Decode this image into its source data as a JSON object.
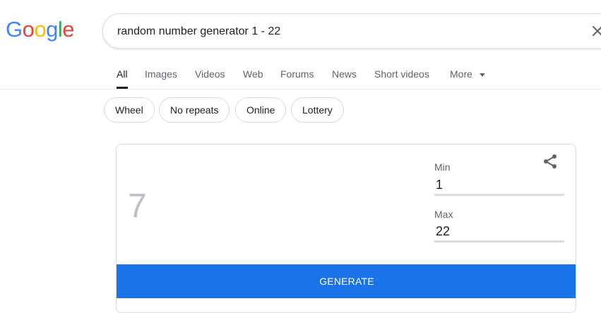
{
  "logo": {
    "letters": [
      "G",
      "o",
      "o",
      "g",
      "l",
      "e"
    ],
    "colors": [
      "#4285f4",
      "#ea4335",
      "#fbbc05",
      "#4285f4",
      "#34a853",
      "#ea4335"
    ]
  },
  "search": {
    "value": "random number generator 1 - 22",
    "clear_icon": "close-icon"
  },
  "tabs": [
    {
      "label": "All",
      "active": true
    },
    {
      "label": "Images"
    },
    {
      "label": "Videos"
    },
    {
      "label": "Web"
    },
    {
      "label": "Forums"
    },
    {
      "label": "News"
    },
    {
      "label": "Short videos"
    },
    {
      "label": "More"
    }
  ],
  "chips": [
    "Wheel",
    "No repeats",
    "Online",
    "Lottery"
  ],
  "generator": {
    "result": "7",
    "min_label": "Min",
    "min_value": "1",
    "max_label": "Max",
    "max_value": "22",
    "generate_label": "GENERATE",
    "share_icon": "share-icon",
    "button_color": "#1a73e8"
  }
}
